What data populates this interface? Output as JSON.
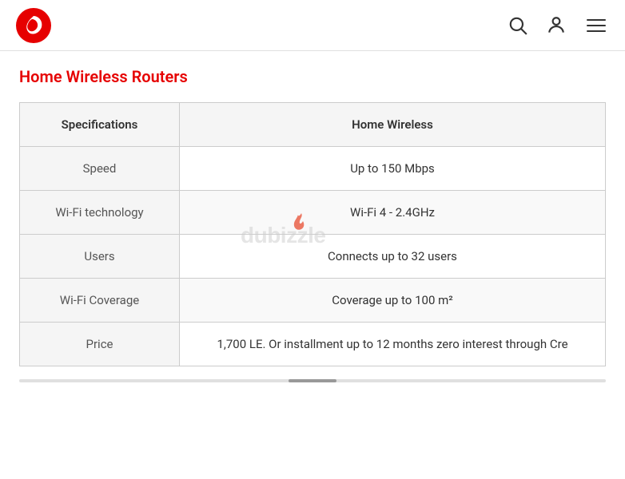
{
  "navbar": {
    "logo_alt": "Vodafone logo",
    "search_icon": "search",
    "user_icon": "user",
    "menu_icon": "hamburger"
  },
  "page": {
    "title": "Home Wireless Routers"
  },
  "table": {
    "col_header_specs": "Specifications",
    "col_header_product": "Home Wireless",
    "rows": [
      {
        "label": "Speed",
        "value": "Up to 150 Mbps"
      },
      {
        "label": "Wi-Fi technology",
        "value": "Wi-Fi 4 - 2.4GHz"
      },
      {
        "label": "Users",
        "value": "Connects up to 32 users"
      },
      {
        "label": "Wi-Fi Coverage",
        "value": "Coverage up to 100 m²"
      },
      {
        "label": "Price",
        "value": "1,700 LE. Or installment up to 12 months zero interest through Cre"
      }
    ]
  },
  "brand": {
    "accent_color": "#e60000"
  }
}
